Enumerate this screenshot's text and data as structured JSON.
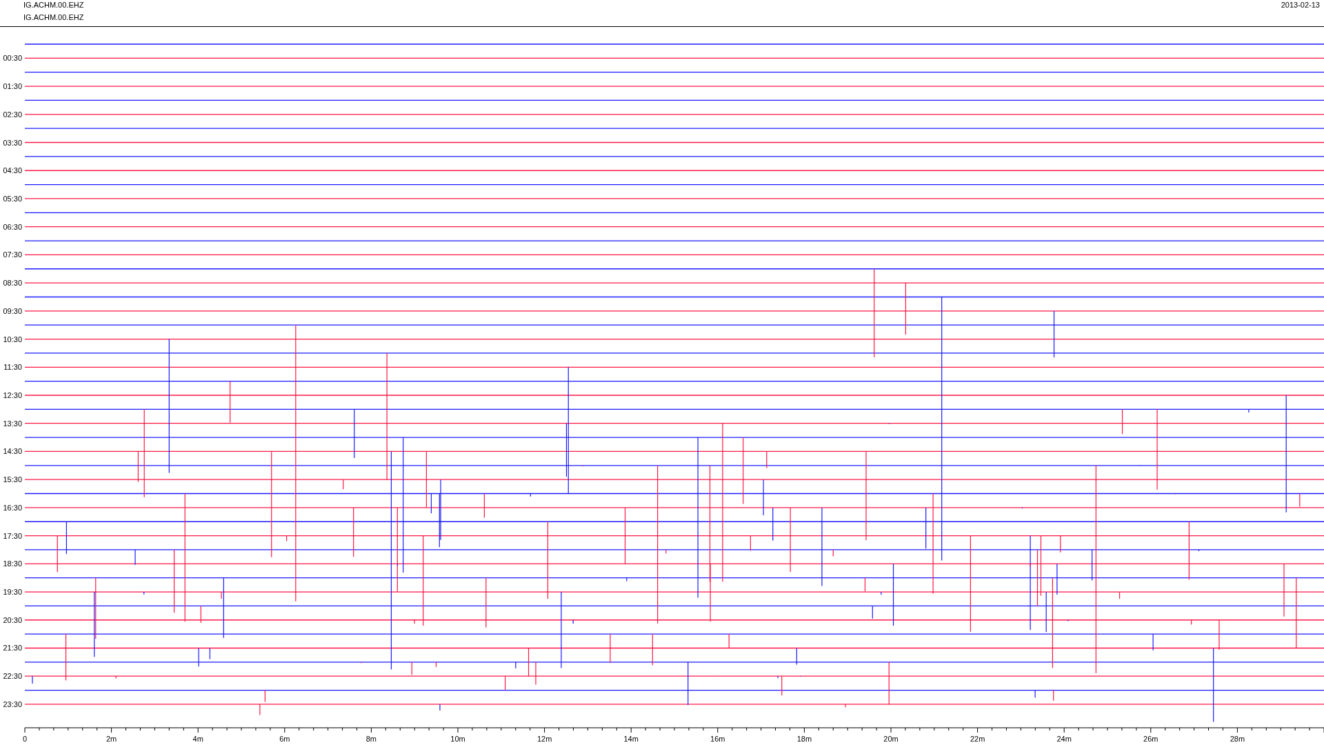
{
  "header": {
    "station_lines": [
      "IG.ACHM.00.EHZ",
      "IG.ACHM.00.EHZ"
    ],
    "date": "2013-02-13"
  },
  "plot": {
    "row_labels": [
      "00:30",
      "01:30",
      "02:30",
      "03:30",
      "04:30",
      "05:30",
      "06:30",
      "07:30",
      "08:30",
      "09:30",
      "10:30",
      "11:30",
      "12:30",
      "13:30",
      "14:30",
      "15:30",
      "16:30",
      "17:30",
      "18:30",
      "19:30",
      "20:30",
      "21:30",
      "22:30",
      "23:30"
    ],
    "x_labels": [
      "0",
      "2m",
      "4m",
      "6m",
      "8m",
      "10m",
      "12m",
      "14m",
      "16m",
      "18m",
      "20m",
      "22m",
      "24m",
      "26m",
      "28m"
    ]
  }
}
